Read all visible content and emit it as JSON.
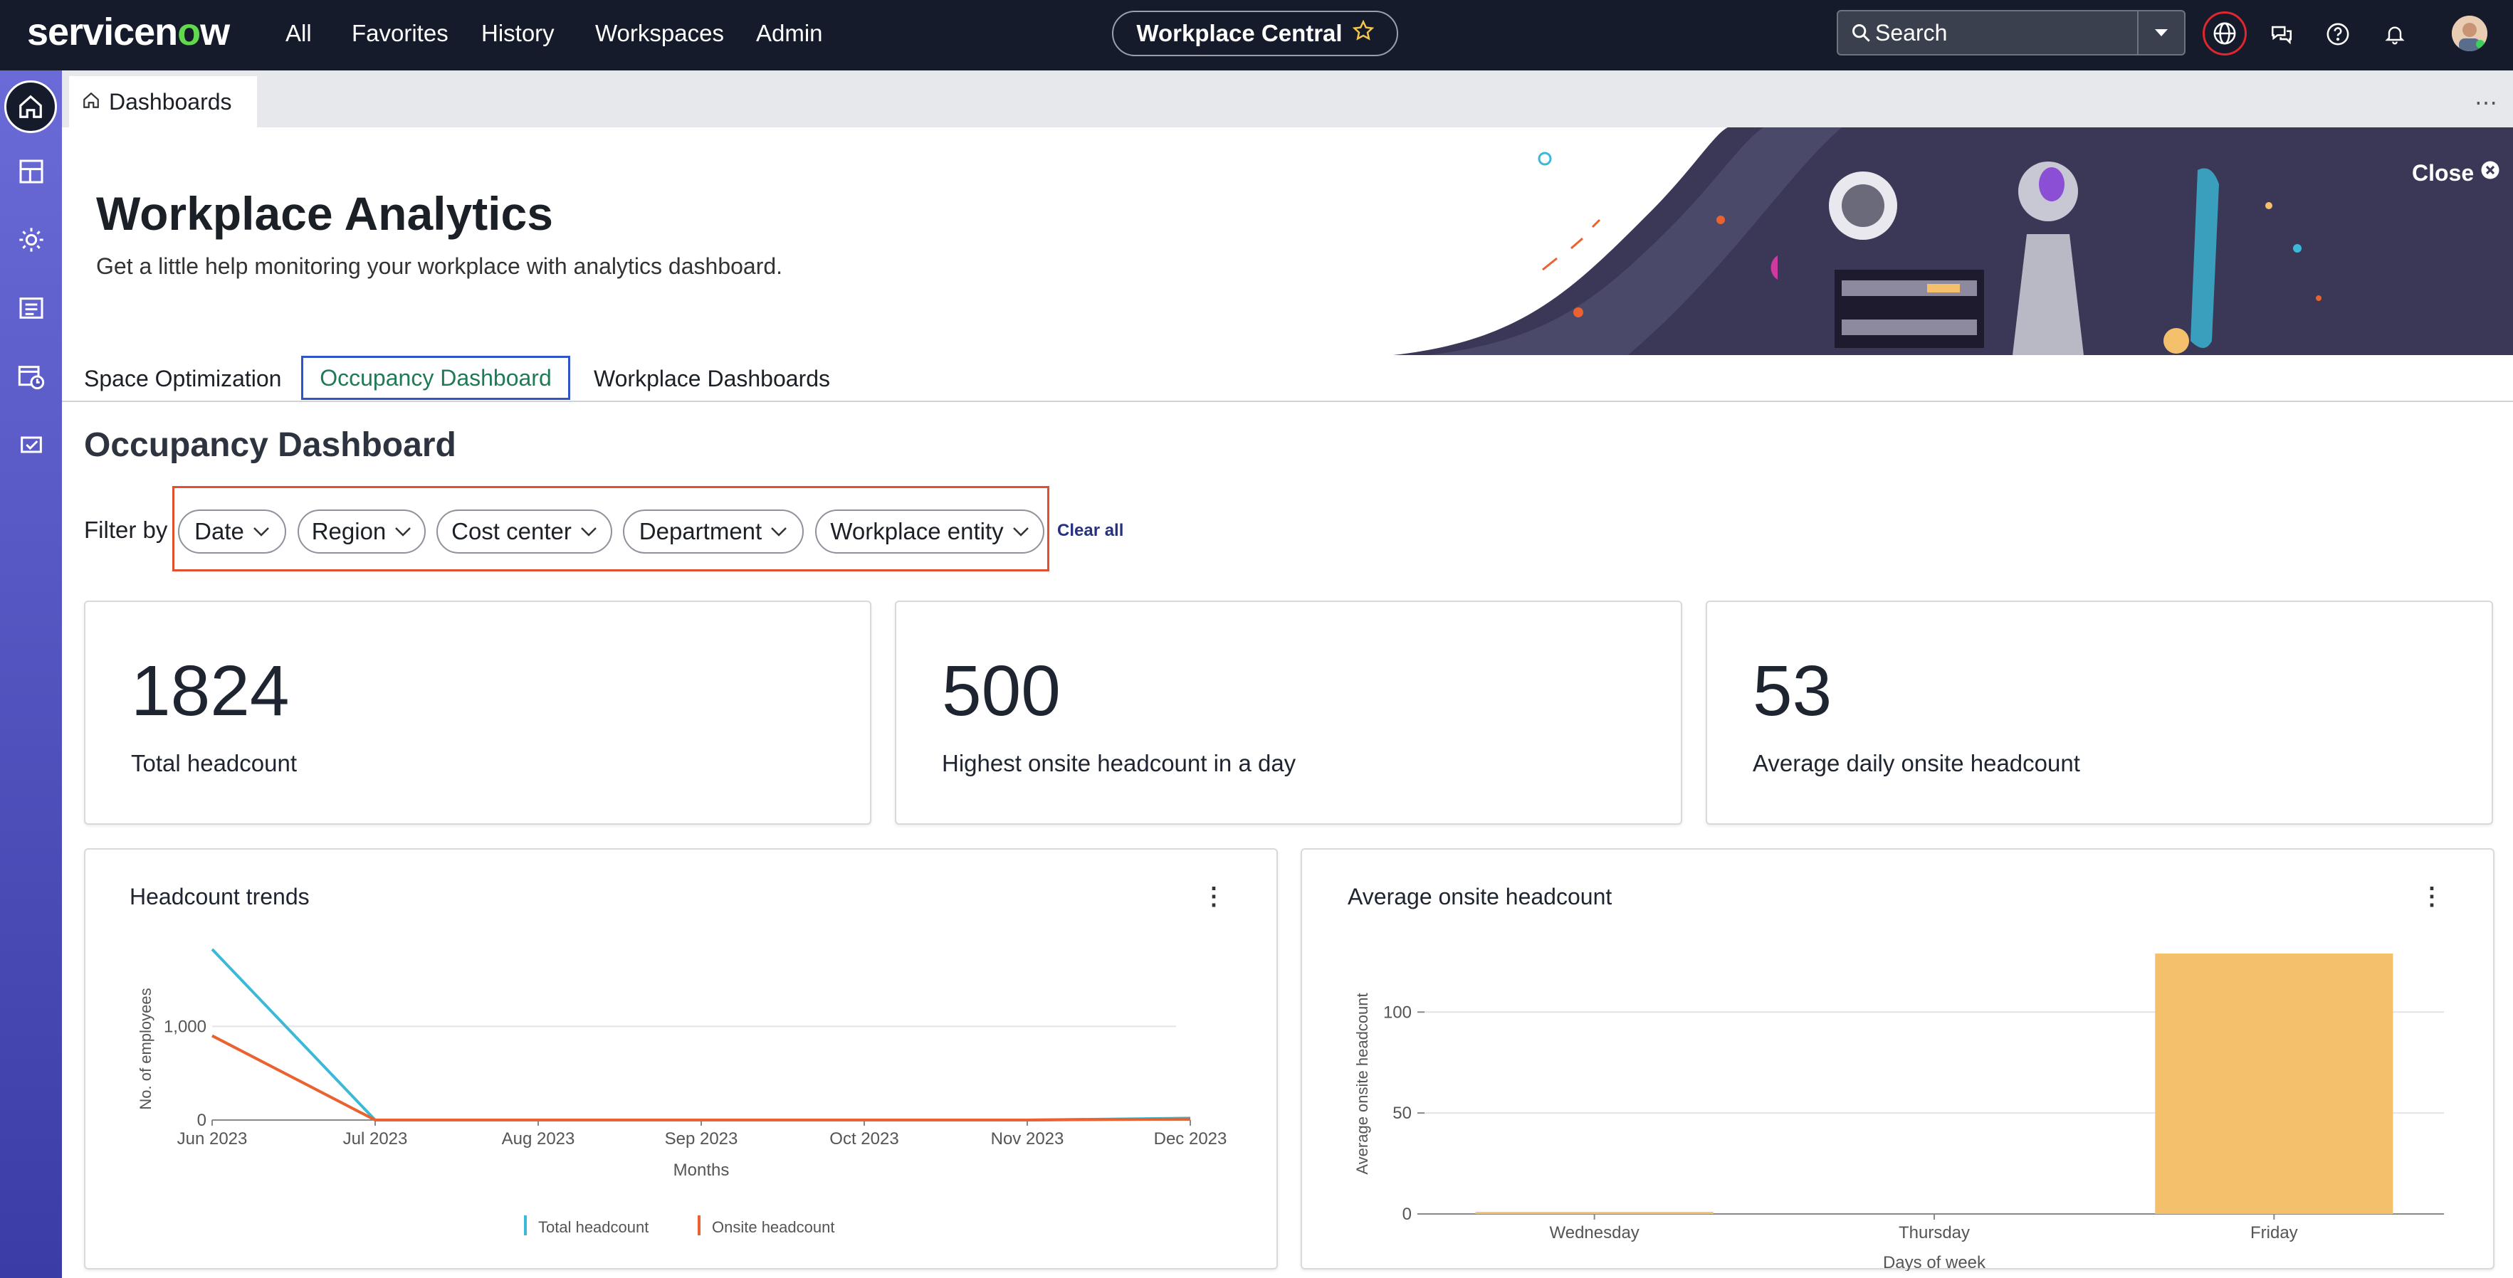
{
  "topbar": {
    "logo": "servicenow",
    "nav": [
      "All",
      "Favorites",
      "History",
      "Workspaces",
      "Admin"
    ],
    "workspace_pill": "Workplace Central",
    "search_placeholder": "Search",
    "icons": [
      "globe-icon",
      "chat-icon",
      "help-icon",
      "bell-icon",
      "avatar"
    ]
  },
  "sidebar": {
    "icons": [
      "home-icon",
      "layout-icon",
      "settings-cog-icon",
      "list-icon",
      "calendar-clock-icon",
      "checkbox-icon"
    ]
  },
  "tabstrip": {
    "tab_label": "Dashboards"
  },
  "banner": {
    "title": "Workplace Analytics",
    "subtitle": "Get a little help monitoring your workplace with analytics dashboard.",
    "close_label": "Close"
  },
  "tabs": [
    {
      "label": "Space Optimization",
      "active": false
    },
    {
      "label": "Occupancy Dashboard",
      "active": true
    },
    {
      "label": "Workplace Dashboards",
      "active": false
    }
  ],
  "section_title": "Occupancy Dashboard",
  "filters": {
    "label": "Filter by",
    "chips": [
      "Date",
      "Region",
      "Cost center",
      "Department",
      "Workplace entity"
    ],
    "clear_label": "Clear all"
  },
  "kpis": [
    {
      "value": "1824",
      "label": "Total headcount"
    },
    {
      "value": "500",
      "label": "Highest onsite headcount in a day"
    },
    {
      "value": "53",
      "label": "Average daily onsite headcount"
    }
  ],
  "colors": {
    "total_headcount": "#3bb9d6",
    "onsite_headcount": "#e9622f",
    "bar": "#f5c06b",
    "accent_blue": "#2f55c9",
    "sidebar": "#5858c8"
  },
  "chart_data": [
    {
      "type": "line",
      "title": "Headcount trends",
      "xlabel": "Months",
      "ylabel": "No. of employees",
      "categories": [
        "Jun 2023",
        "Jul 2023",
        "Aug 2023",
        "Sep 2023",
        "Oct 2023",
        "Nov 2023",
        "Dec 2023"
      ],
      "yticks": [
        "0",
        "1,000"
      ],
      "ylim": [
        0,
        1824
      ],
      "series": [
        {
          "name": "Total headcount",
          "values": [
            1824,
            0,
            0,
            0,
            0,
            0,
            20
          ]
        },
        {
          "name": "Onsite headcount",
          "values": [
            900,
            0,
            0,
            0,
            0,
            0,
            10
          ]
        }
      ],
      "legend": "bottom",
      "grid": true
    },
    {
      "type": "bar",
      "title": "Average onsite headcount",
      "xlabel": "Days of week",
      "ylabel": "Average onsite headcount",
      "categories": [
        "Wednesday",
        "Thursday",
        "Friday"
      ],
      "values": [
        1,
        0,
        129
      ],
      "yticks": [
        "0",
        "50",
        "100"
      ],
      "ylim": [
        0,
        129
      ],
      "grid": true
    }
  ]
}
